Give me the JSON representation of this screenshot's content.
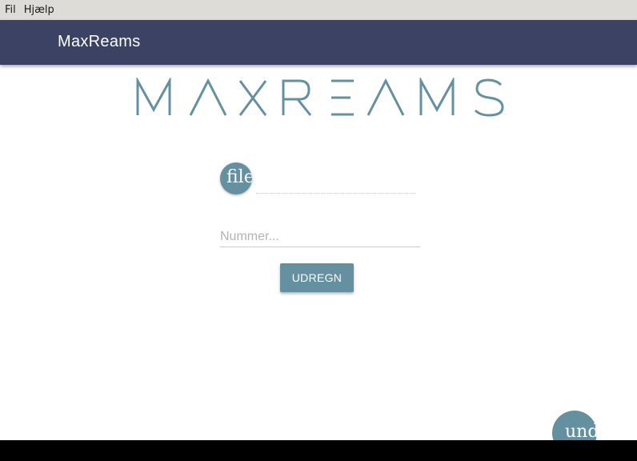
{
  "menubar": {
    "items": [
      {
        "label": "Fil"
      },
      {
        "label": "Hjælp"
      }
    ]
  },
  "appbar": {
    "title": "MaxReams"
  },
  "logo": {
    "text": "MAXREAMS",
    "color": "#64909f"
  },
  "file_button": {
    "label": "file"
  },
  "number_input": {
    "placeholder": "Nummer...",
    "value": ""
  },
  "calculate_button": {
    "label": "UDREGN"
  },
  "undo_button": {
    "label": "undo"
  },
  "colors": {
    "appbar": "#3b4263",
    "accent": "#64909f",
    "menubar": "#dedcd7"
  }
}
